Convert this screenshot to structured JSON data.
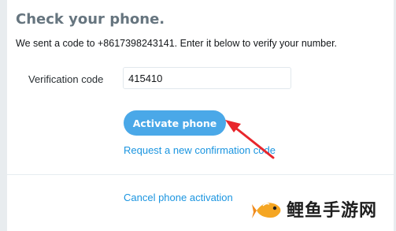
{
  "page": {
    "title": "Check your phone.",
    "subtitle": "We sent a code to +8617398243141. Enter it below to verify your number."
  },
  "form": {
    "code_label": "Verification code",
    "code_value": "415410"
  },
  "actions": {
    "activate_label": "Activate phone",
    "request_label": "Request a new confirmation code",
    "cancel_label": "Cancel phone activation"
  },
  "annotation": {
    "arrow_color": "#e8262c",
    "arrow_icon": "red-arrow-icon"
  },
  "watermark": {
    "text": "鲤鱼手游网",
    "logo_icon": "fish-logo-icon"
  },
  "colors": {
    "button": "#4aa8e8",
    "link": "#1b95e0",
    "title": "#66757f"
  }
}
